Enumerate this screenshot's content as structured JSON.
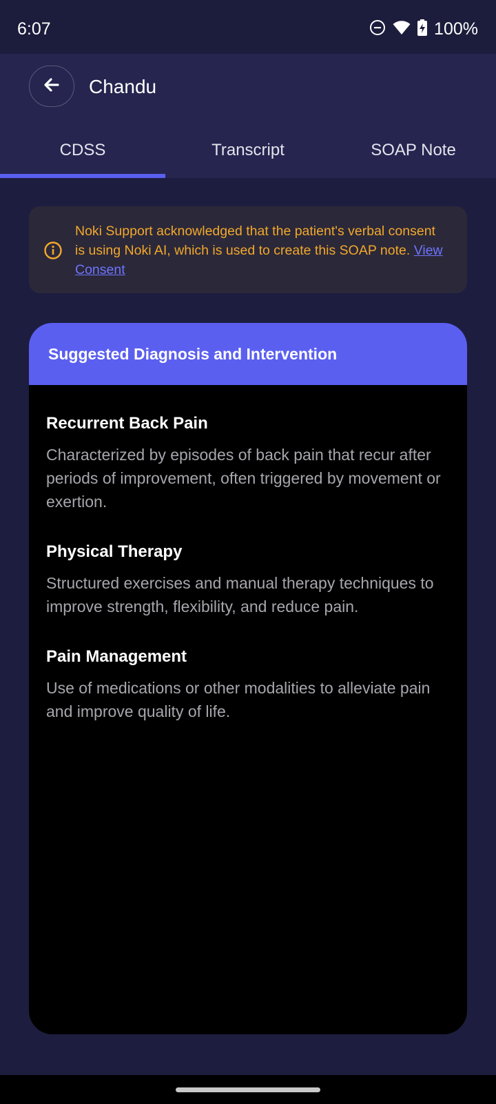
{
  "status_bar": {
    "time": "6:07",
    "battery": "100%",
    "icons": [
      "do-not-disturb-icon",
      "wifi-icon",
      "battery-charging-icon"
    ]
  },
  "app_bar": {
    "title": "Chandu",
    "back_icon": "arrow-left-icon"
  },
  "tabs": [
    {
      "label": "CDSS",
      "active": true
    },
    {
      "label": "Transcript",
      "active": false
    },
    {
      "label": "SOAP Note",
      "active": false
    }
  ],
  "consent": {
    "icon": "info-icon",
    "text": "Noki Support acknowledged that the patient's verbal consent is using Noki AI, which is used to create this SOAP note. ",
    "link_label": "View Consent"
  },
  "card": {
    "title": "Suggested Diagnosis and Intervention",
    "items": [
      {
        "title": "Recurrent Back Pain",
        "description": "Characterized by episodes of back pain that recur after periods of improvement, often triggered by movement or exertion."
      },
      {
        "title": "Physical Therapy",
        "description": "Structured exercises and manual therapy techniques to improve strength, flexibility, and reduce pain."
      },
      {
        "title": "Pain Management",
        "description": "Use of medications or other modalities to alleviate pain and improve quality of life."
      }
    ]
  },
  "colors": {
    "accent": "#5b5ff0",
    "warning": "#f2a82c",
    "link": "#6f74ff",
    "background": "#1d1d40",
    "app_bar": "#25254f"
  }
}
